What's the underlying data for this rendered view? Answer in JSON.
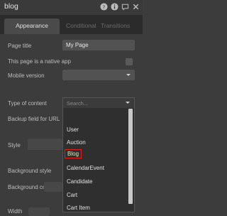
{
  "header": {
    "title": "blog"
  },
  "tabs": [
    "Appearance",
    "Conditional",
    "Transitions"
  ],
  "fields": {
    "page_title_label": "Page title",
    "page_title_value": "My Page",
    "native_app_label": "This page is a native app",
    "mobile_version_label": "Mobile version",
    "type_of_content_label": "Type of content",
    "type_of_content_placeholder": "Search...",
    "backup_field_label": "Backup field for URL",
    "style_label": "Style",
    "background_style_label": "Background style",
    "background_color_label": "Background color",
    "width_label": "Width"
  },
  "dropdown": {
    "items": [
      "User",
      "Auction",
      "Blog",
      "CalendarEvent",
      "Candidate",
      "Cart",
      "Cart Item"
    ],
    "selected": "Blog"
  },
  "colors": {
    "selection_outline": "#e02020"
  }
}
